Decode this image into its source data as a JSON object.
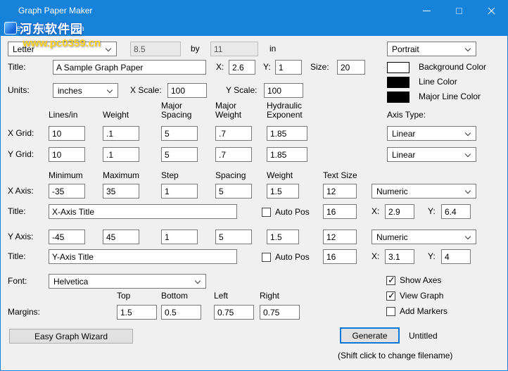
{
  "window": {
    "title": "Graph Paper Maker",
    "menu": [
      "File",
      "Edit",
      "Graph"
    ]
  },
  "watermark": {
    "site_name": "河东软件园",
    "site_url": "www.pc0359.cn"
  },
  "paper": {
    "size": "Letter",
    "width": "8.5",
    "by": "by",
    "height": "11",
    "unit": "in",
    "orientation": "Portrait"
  },
  "graph_title": {
    "label": "Title:",
    "value": "A Sample Graph Paper",
    "x_label": "X:",
    "x": "2.6",
    "y_label": "Y:",
    "y": "1",
    "size_label": "Size:",
    "size": "20"
  },
  "color_settings": {
    "background": {
      "label": "Background Color",
      "color": "#ffffff"
    },
    "line": {
      "label": "Line Color",
      "color": "#000000"
    },
    "major_line": {
      "label": "Major Line Color",
      "color": "#000000"
    }
  },
  "units": {
    "label": "Units:",
    "value": "inches"
  },
  "scale": {
    "x_label": "X Scale:",
    "x": "100",
    "y_label": "Y Scale:",
    "y": "100"
  },
  "grid": {
    "headers": [
      "Lines/in",
      "Weight",
      "Major\nSpacing",
      "Major\nWeight",
      "Hydraulic\nExponent"
    ],
    "x": {
      "label": "X Grid:",
      "lines_in": "10",
      "weight": ".1",
      "major_spacing": "5",
      "major_weight": ".7",
      "hydraulic_exponent": "1.85"
    },
    "y": {
      "label": "Y Grid:",
      "lines_in": "10",
      "weight": ".1",
      "major_spacing": "5",
      "major_weight": ".7",
      "hydraulic_exponent": "1.85"
    }
  },
  "axis_type": {
    "label": "Axis Type:",
    "x": "Linear",
    "y": "Linear"
  },
  "axes": {
    "headers": [
      "Minimum",
      "Maximum",
      "Step",
      "Spacing",
      "Weight",
      "Text Size"
    ],
    "x": {
      "label": "X Axis:",
      "min": "-35",
      "max": "35",
      "step": "1",
      "spacing": "5",
      "weight": "1.5",
      "text_size": "12",
      "format": "Numeric"
    },
    "x_title": {
      "label": "Title:",
      "value": "X-Axis Title",
      "auto_pos": "Auto Pos",
      "auto_pos_checked": false,
      "size": "16",
      "x_label": "X:",
      "x": "2.9",
      "y_label": "Y:",
      "y": "6.4"
    },
    "y": {
      "label": "Y Axis:",
      "min": "-45",
      "max": "45",
      "step": "1",
      "spacing": "5",
      "weight": "1.5",
      "text_size": "12",
      "format": "Numeric"
    },
    "y_title": {
      "label": "Title:",
      "value": "Y-Axis Title",
      "auto_pos": "Auto Pos",
      "auto_pos_checked": false,
      "size": "16",
      "x_label": "X:",
      "x": "3.1",
      "y_label": "Y:",
      "y": "4"
    }
  },
  "font": {
    "label": "Font:",
    "value": "Helvetica"
  },
  "options": {
    "show_axes": {
      "label": "Show Axes",
      "checked": true
    },
    "view_graph": {
      "label": "View Graph",
      "checked": true
    },
    "add_markers": {
      "label": "Add Markers",
      "checked": false
    }
  },
  "margins": {
    "label": "Margins:",
    "headers": [
      "Top",
      "Bottom",
      "Left",
      "Right"
    ],
    "top": "1.5",
    "bottom": "0.5",
    "left": "0.75",
    "right": "0.75"
  },
  "actions": {
    "wizard": "Easy Graph Wizard",
    "generate": "Generate",
    "filename": "Untitled",
    "hint": "(Shift click to change filename)"
  }
}
